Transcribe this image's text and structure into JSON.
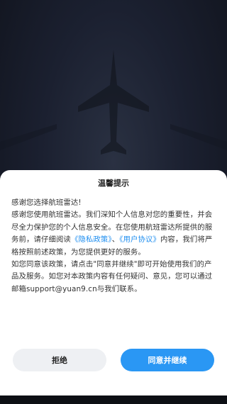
{
  "dialog": {
    "title": "温馨提示",
    "greeting": "感谢您选择航班雷达!",
    "para1_pre": "感谢您使用航班雷达。我们深知个人信息对您的重要性，并会尽全力保护您的个人信息安全。在您使用航班雷达所提供的服务前，请仔细阅读",
    "privacy_link": "《隐私政策》",
    "para1_sep": "、",
    "terms_link": "《用户协议》",
    "para1_post": "内容，我们将严格按照前述政策，为您提供更好的服务。",
    "para2": "如您同意该政策，请点击\"同意并继续\"即可开始使用我们的产品及服务。如您对本政策内容有任何疑问、意见，您可以通过邮箱support@yuan9.cn与我们联系。",
    "reject_label": "拒绝",
    "agree_label": "同意并继续"
  },
  "colors": {
    "accent": "#2a97f4",
    "link": "#1e8ef0",
    "background": "#1b2030"
  }
}
